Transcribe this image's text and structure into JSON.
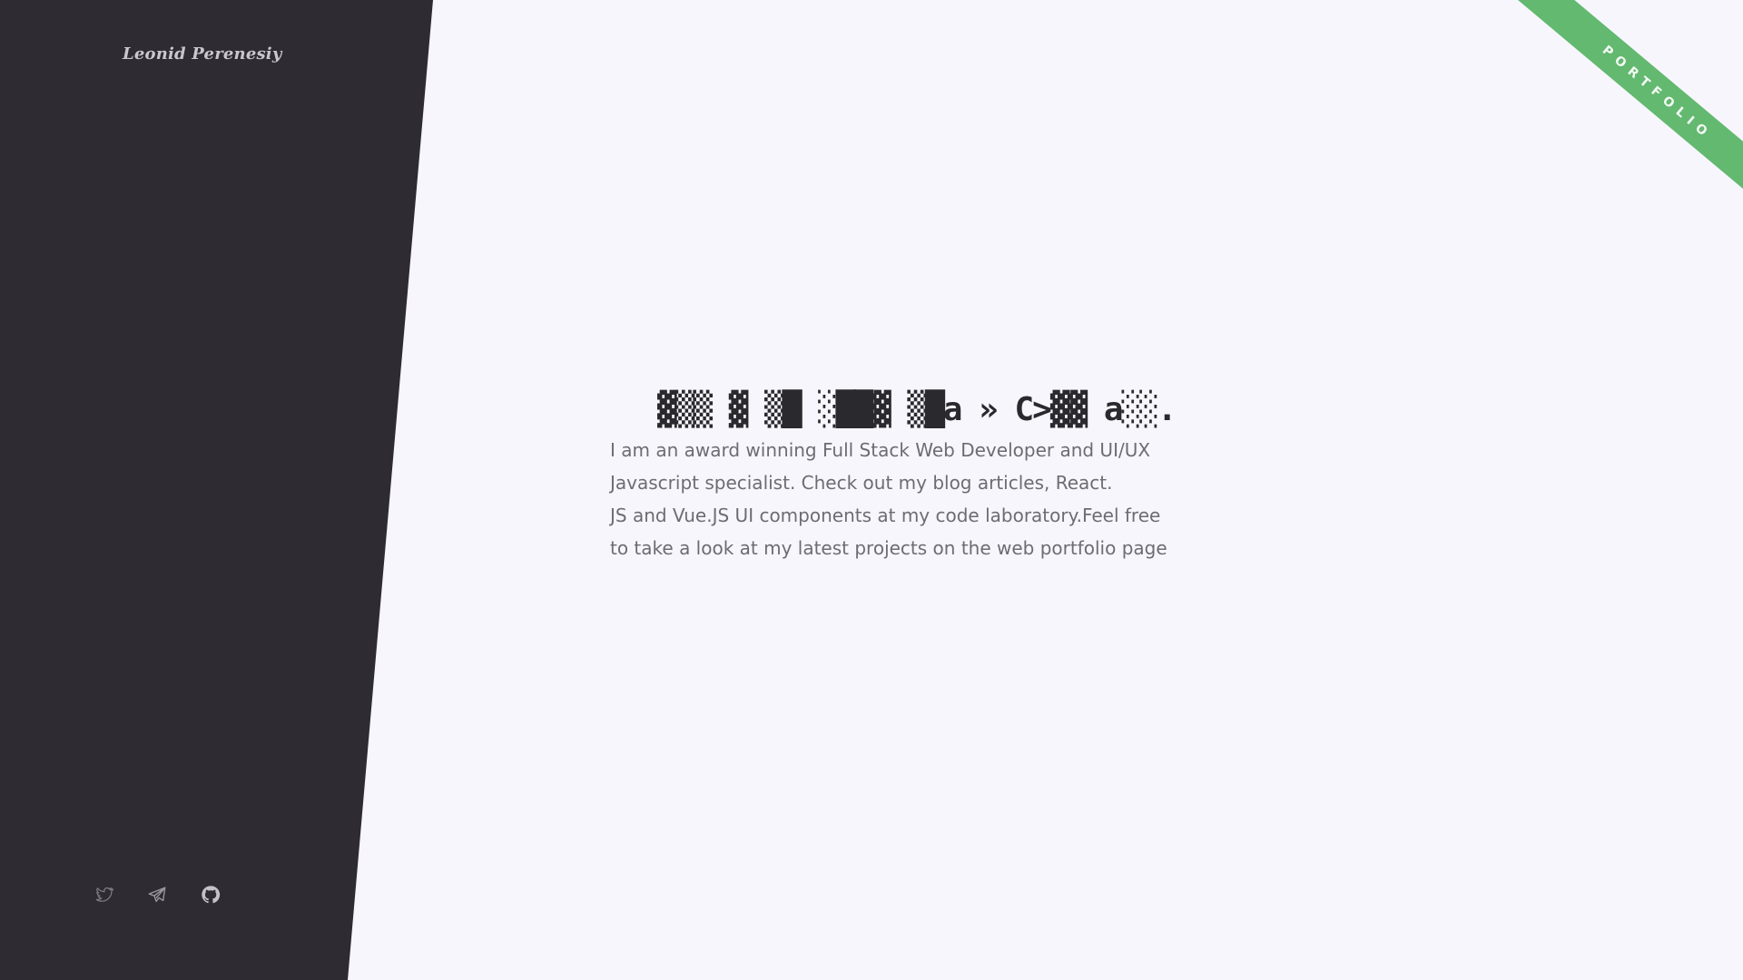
{
  "sidebar": {
    "brand": "Leonid Perenesiy",
    "social": [
      {
        "icon": "twitter-icon"
      },
      {
        "icon": "telegram-icon"
      },
      {
        "icon": "github-icon"
      }
    ]
  },
  "ribbon": {
    "label": "PORTFOLIO",
    "color": "#62b96f"
  },
  "hero": {
    "headline": "▓▒▒ ▓ ▒█ ░██▓ ▒█a » C>▓▓ a░░.",
    "intro_lines": [
      "I am an award winning Full Stack Web Developer and UI/UX",
      "Javascript specialist. Check out my blog articles, React.",
      "JS and Vue.JS UI components at my code laboratory.Feel free",
      "to take a look at my latest projects on the web portfolio page"
    ]
  },
  "colors": {
    "sidebar_bg": "#2e2c32",
    "page_bg": "#f7f6fd",
    "text": "#6d6c72"
  }
}
